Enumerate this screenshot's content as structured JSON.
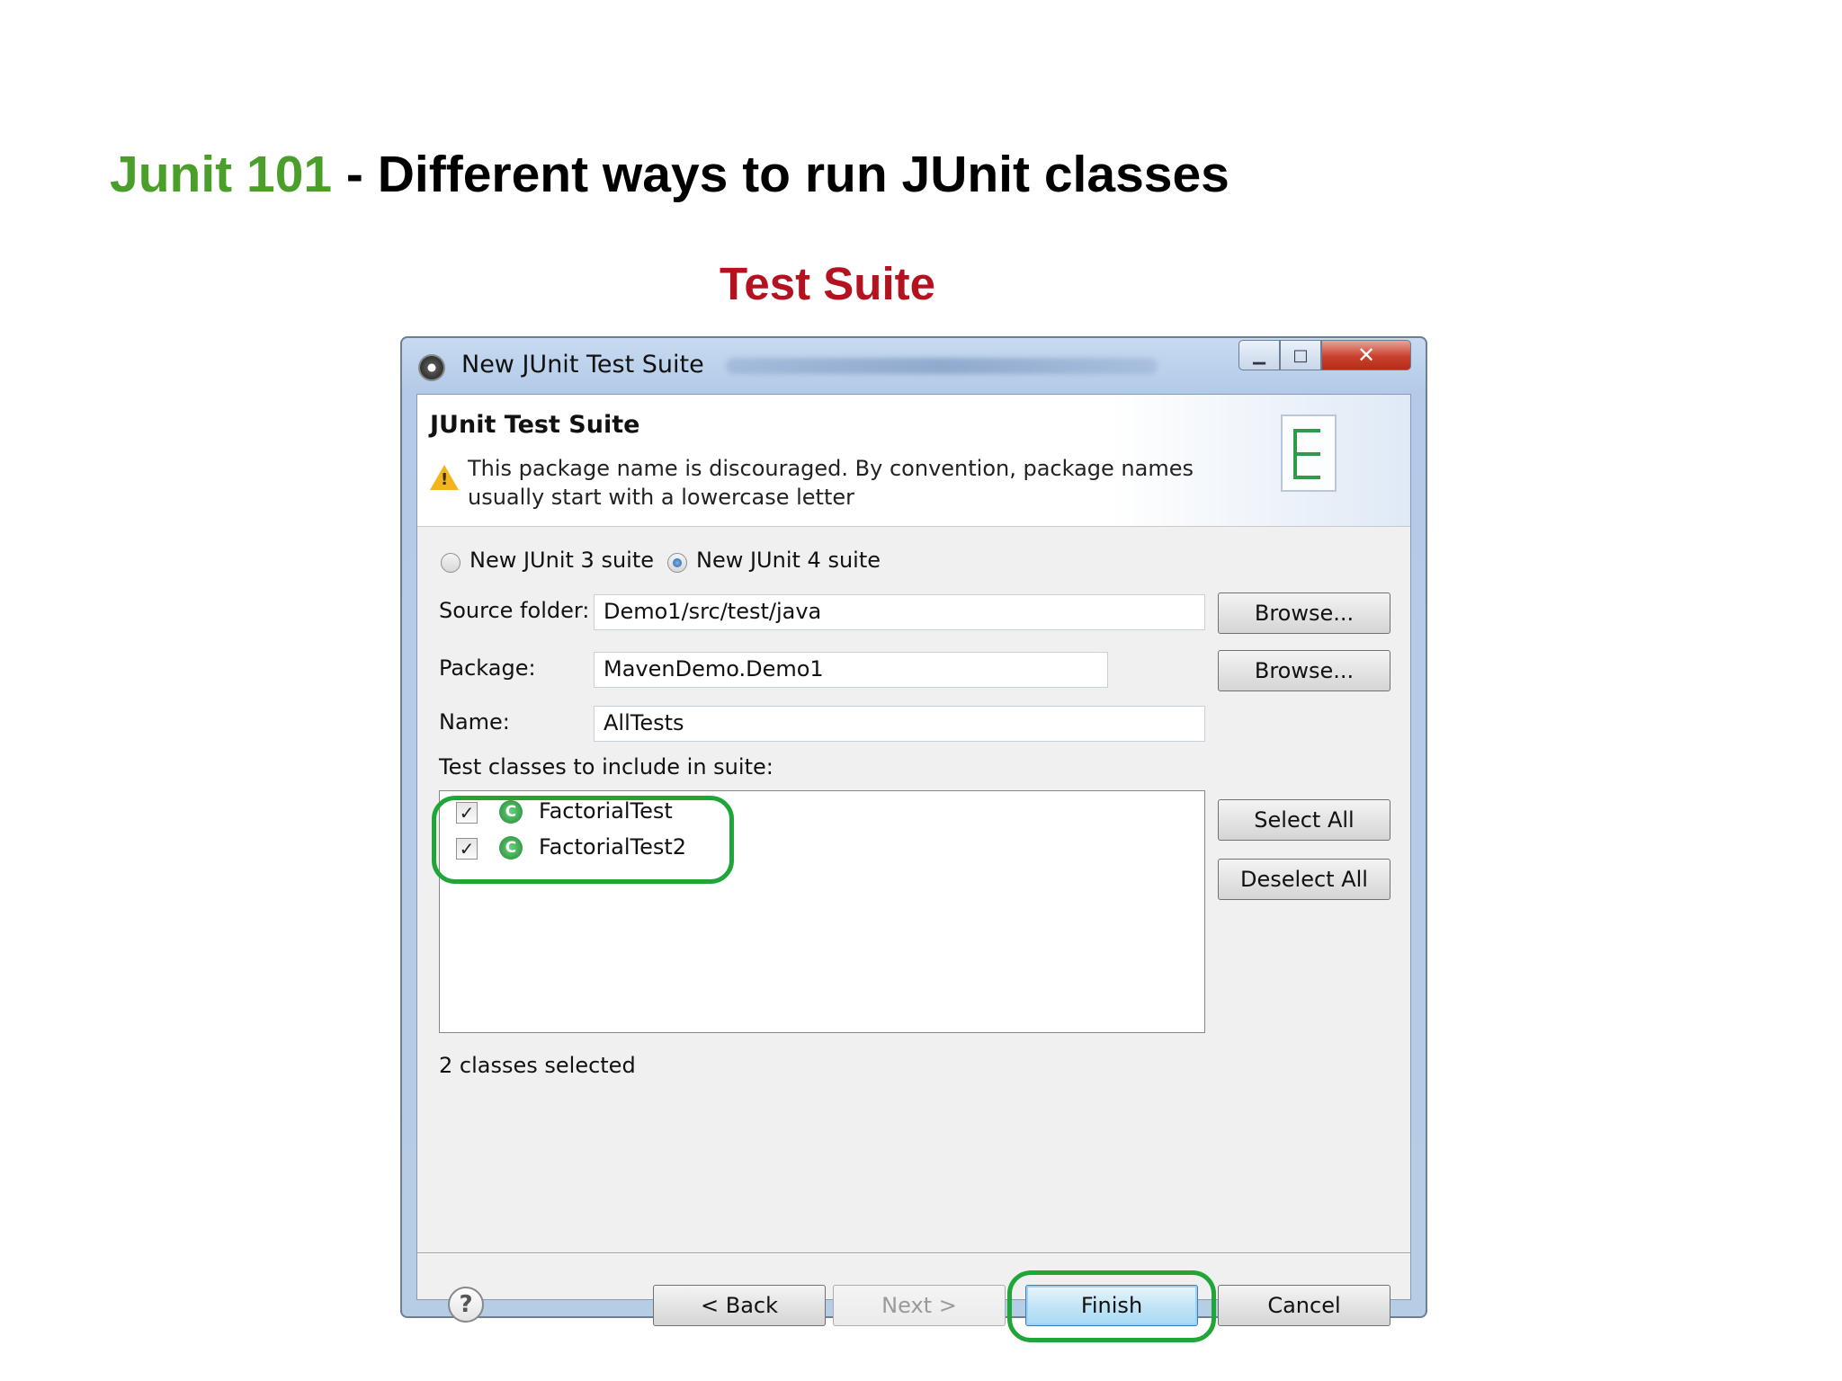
{
  "slide": {
    "title_accent": "Junit 101",
    "title_rest": " - Different ways to run JUnit classes",
    "subtitle": "Test Suite"
  },
  "window": {
    "title": "New JUnit Test Suite",
    "controls": {
      "minimize": "▁",
      "maximize": "□",
      "close": "✕"
    }
  },
  "banner": {
    "title": "JUnit Test Suite",
    "message": "This package name is discouraged. By convention, package names usually start with a lowercase letter",
    "warning_icon": "warning-icon"
  },
  "form": {
    "radio_junit3": "New JUnit 3 suite",
    "radio_junit4": "New JUnit 4 suite",
    "selected_radio": "New JUnit 4 suite",
    "source_folder_label": "Source folder:",
    "source_folder_value": "Demo1/src/test/java",
    "package_label": "Package:",
    "package_value": "MavenDemo.Demo1",
    "name_label": "Name:",
    "name_value": "AllTests",
    "browse_label": "Browse...",
    "classes_label": "Test classes to include in suite:",
    "classes": [
      {
        "name": "FactorialTest",
        "checked": true
      },
      {
        "name": "FactorialTest2",
        "checked": true
      }
    ],
    "check_mark": "✓",
    "class_icon_letter": "C",
    "select_all": "Select All",
    "deselect_all": "Deselect All",
    "status": "2 classes selected"
  },
  "footer": {
    "help": "?",
    "back": "< Back",
    "next": "Next >",
    "finish": "Finish",
    "cancel": "Cancel"
  },
  "colors": {
    "title_accent": "#4a9e2a",
    "subtitle": "#b3121e",
    "highlight": "#1fa538"
  }
}
